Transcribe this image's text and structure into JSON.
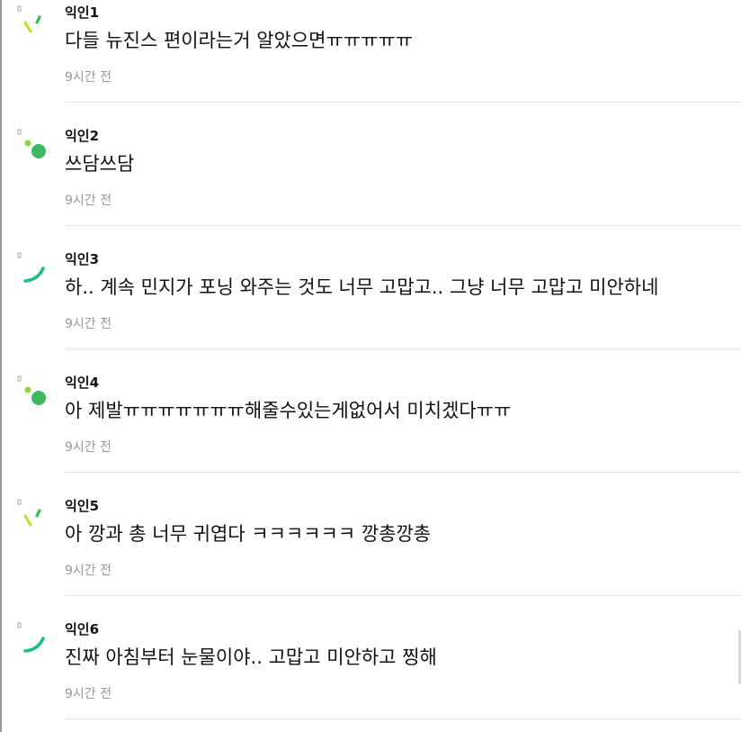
{
  "comments": [
    {
      "author": "익인1",
      "body": "다들 뉴진스 편이라는거 알았으면ㅠㅠㅠㅠㅠ",
      "time": "9시간 전",
      "avatar_icon": "dash-avatar-icon",
      "avatar_colors": [
        "#c6dc2e"
      ]
    },
    {
      "author": "익인2",
      "body": "쓰담쓰담",
      "time": "9시간 전",
      "avatar_icon": "dot-circle-avatar-icon",
      "avatar_colors": [
        "#8fd83a",
        "#3fb862"
      ]
    },
    {
      "author": "익인3",
      "body": "하.. 계속 민지가 포닝 와주는 것도 너무 고맙고.. 그냥 너무 고맙고 미안하네",
      "time": "9시간 전",
      "avatar_icon": "arc-avatar-icon",
      "avatar_colors": [
        "#1fbd86"
      ]
    },
    {
      "author": "익인4",
      "body": "아 제발ㅠㅠㅠㅠㅠㅠㅠ해줄수있는게없어서 미치겠다ㅠㅠ",
      "time": "9시간 전",
      "avatar_icon": "dot-circle-avatar-icon",
      "avatar_colors": [
        "#8fd83a",
        "#3fb862"
      ]
    },
    {
      "author": "익인5",
      "body": "아 깡과 총 너무 귀엽다 ㅋㅋㅋㅋㅋㅋ 깡총깡총",
      "time": "9시간 전",
      "avatar_icon": "dash-avatar-icon",
      "avatar_colors": [
        "#c6dc2e"
      ]
    },
    {
      "author": "익인6",
      "body": "진짜 아침부터 눈물이야.. 고맙고 미안하고 찡해",
      "time": "9시간 전",
      "avatar_icon": "arc-avatar-icon",
      "avatar_colors": [
        "#1fbd86"
      ]
    }
  ]
}
